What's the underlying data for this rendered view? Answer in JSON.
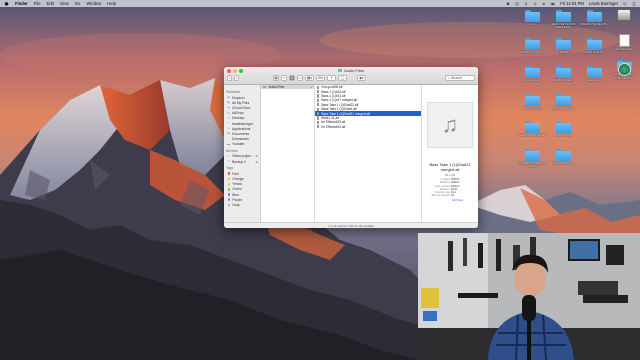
{
  "menubar": {
    "app": "Finder",
    "items": [
      "File",
      "Edit",
      "View",
      "Go",
      "Window",
      "Help"
    ],
    "clock": "Fri 11:04 PM",
    "user": "Lewis Barringer"
  },
  "desktop_icons": [
    {
      "label": "",
      "kind": "drive"
    },
    {
      "label": "Macintosh HD",
      "kind": "drive"
    },
    {
      "label": "Ore",
      "kind": "folder"
    },
    {
      "label": "DEMO SESSIONS REMIXES",
      "kind": "folder"
    },
    {
      "label": "DEMO PROJECTS",
      "kind": "folder"
    },
    {
      "label": "Lewis Projects",
      "kind": "folder"
    },
    {
      "label": "Ableton projects",
      "kind": "folder"
    },
    {
      "label": "TITLES",
      "kind": "folder"
    },
    {
      "label": "Video projects",
      "kind": "folder"
    },
    {
      "label": "Video Apps",
      "kind": "folder"
    },
    {
      "label": "DEMO VIDEO",
      "kind": "folder"
    },
    {
      "label": "Time Machine",
      "kind": "tm"
    },
    {
      "label": "Audio Files",
      "kind": "folder"
    },
    {
      "label": "Sample Library",
      "kind": "folder"
    },
    {
      "label": "Ableton Loops",
      "kind": "folder"
    },
    {
      "label": "Spotify Play ALL",
      "kind": "folder"
    },
    {
      "label": "Bonus Songs",
      "kind": "folder"
    },
    {
      "label": "DEMO Audio Folder",
      "kind": "folder"
    },
    {
      "label": "My Better Unfinished Songs",
      "kind": "folder"
    }
  ],
  "finder": {
    "window_title": "Audio Files",
    "search_placeholder": "Search",
    "sidebar": {
      "favorites_header": "Favorites",
      "favorites": [
        {
          "label": "Dropbox",
          "icon": "dropbox-icon",
          "glyph": "◆"
        },
        {
          "label": "All My Files",
          "icon": "all-files-icon",
          "glyph": "▤"
        },
        {
          "label": "iCloud Drive",
          "icon": "cloud-icon",
          "glyph": "☁"
        },
        {
          "label": "AirDrop",
          "icon": "airdrop-icon",
          "glyph": "◎"
        },
        {
          "label": "Desktop",
          "icon": "desktop-icon",
          "glyph": "▭"
        },
        {
          "label": "lewisbarringer",
          "icon": "home-icon",
          "glyph": "⌂"
        },
        {
          "label": "Applications",
          "icon": "applications-icon",
          "glyph": "A"
        },
        {
          "label": "Documents",
          "icon": "documents-icon",
          "glyph": "▤"
        },
        {
          "label": "Downloads",
          "icon": "downloads-icon",
          "glyph": "↓"
        },
        {
          "label": "Youtube",
          "icon": "folder-icon",
          "glyph": "▬"
        }
      ],
      "devices_header": "Devices",
      "devices": [
        {
          "label": "Video projec...",
          "icon": "drive-icon",
          "glyph": "▭"
        },
        {
          "label": "Backup 2",
          "icon": "drive-icon",
          "glyph": "▭"
        }
      ],
      "tags_header": "Tags",
      "tags": [
        {
          "label": "Red",
          "color": "#f0433a"
        },
        {
          "label": "Orange",
          "color": "#f6a431"
        },
        {
          "label": "Yellow",
          "color": "#f5cf32"
        },
        {
          "label": "Green",
          "color": "#5fc148"
        },
        {
          "label": "Blue",
          "color": "#3b8ef0"
        },
        {
          "label": "Purple",
          "color": "#b36ad8"
        },
        {
          "label": "Gray",
          "color": "#9b9b9b"
        }
      ]
    },
    "column1": [
      {
        "label": "Audio Files",
        "selected": true
      }
    ],
    "column2": [
      {
        "label": "2nd gu4#28.aif",
        "selected": false
      },
      {
        "label": "Bass 1 (1)#24.aif",
        "selected": false
      },
      {
        "label": "Bass 1 (1)#13.aif",
        "selected": false
      },
      {
        "label": "Bass 1 (1)#17 merged.aif",
        "selected": false
      },
      {
        "label": "Bass Take 1 (1)00a#22.aif",
        "selected": false
      },
      {
        "label": "Bass Take 1 (1)00a#4.aif",
        "selected": false
      },
      {
        "label": "Bass Take 1 (1)00a#21 merged.aif",
        "selected": true
      },
      {
        "label": "Bell#1 41.aif",
        "selected": false
      },
      {
        "label": "fnr Effects#33.aif",
        "selected": false
      },
      {
        "label": "fnr Effects#34.aif",
        "selected": false
      }
    ],
    "preview": {
      "name": "Bass Take 1 (1)00a#21 merged.aif",
      "kind": "55.1 KB",
      "meta": [
        {
          "k": "Created",
          "v": "3/20/17"
        },
        {
          "k": "Modified",
          "v": "3/20/17"
        },
        {
          "k": "Last opened",
          "v": "3/20/17"
        },
        {
          "k": "Duration",
          "v": "00:01"
        },
        {
          "k": "Sample rate",
          "v": "44.1"
        },
        {
          "k": "Bits per sample",
          "v": "24"
        }
      ],
      "add_tags": "Add Tags..."
    },
    "status": "1 of 10 selected, 309.31 GB available"
  },
  "colors": {
    "selection_blue": "#1f62cf",
    "folder_blue": "#4aa3ea"
  }
}
